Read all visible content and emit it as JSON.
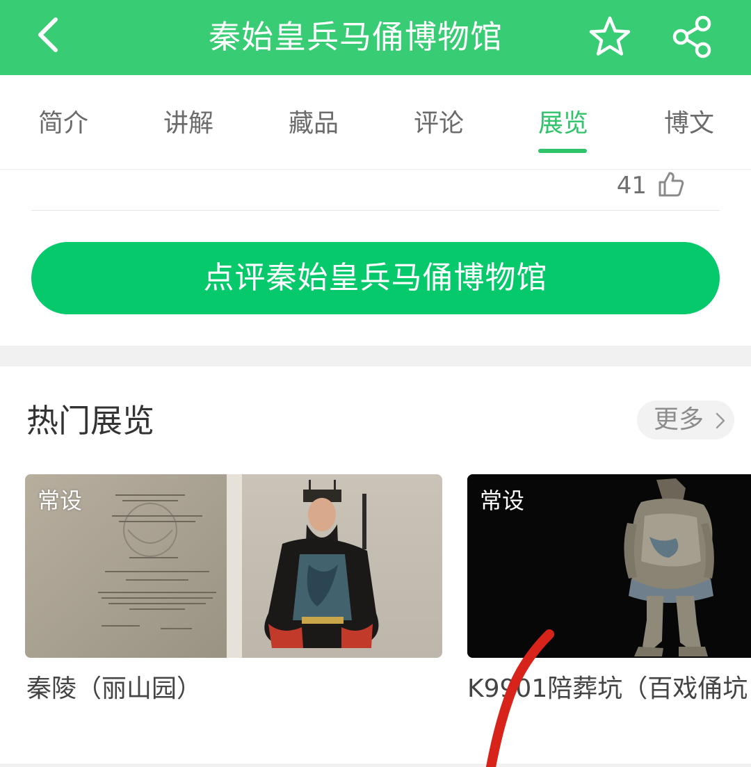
{
  "header": {
    "title": "秦始皇兵马俑博物馆",
    "back_icon": "chevron-left-icon",
    "favorite_icon": "star-icon",
    "share_icon": "share-icon",
    "bg_color": "#38cc74"
  },
  "tabs": [
    {
      "label": "简介",
      "active": false
    },
    {
      "label": "讲解",
      "active": false
    },
    {
      "label": "藏品",
      "active": false
    },
    {
      "label": "评论",
      "active": false
    },
    {
      "label": "展览",
      "active": true
    },
    {
      "label": "博文",
      "active": false
    }
  ],
  "comment": {
    "like_count": "41",
    "like_icon": "thumbs-up-icon"
  },
  "review_button": {
    "label": "点评秦始皇兵马俑博物馆",
    "color": "#05c96b"
  },
  "hot_exhibitions": {
    "title": "热门展览",
    "more_label": "更多",
    "items": [
      {
        "badge": "常设",
        "title": "秦陵（丽山园）"
      },
      {
        "badge": "常设",
        "title": "K9901陪葬坑（百戏俑坑"
      }
    ]
  },
  "colors": {
    "accent_green": "#2fc46a",
    "annotation_red": "#d8231b"
  }
}
